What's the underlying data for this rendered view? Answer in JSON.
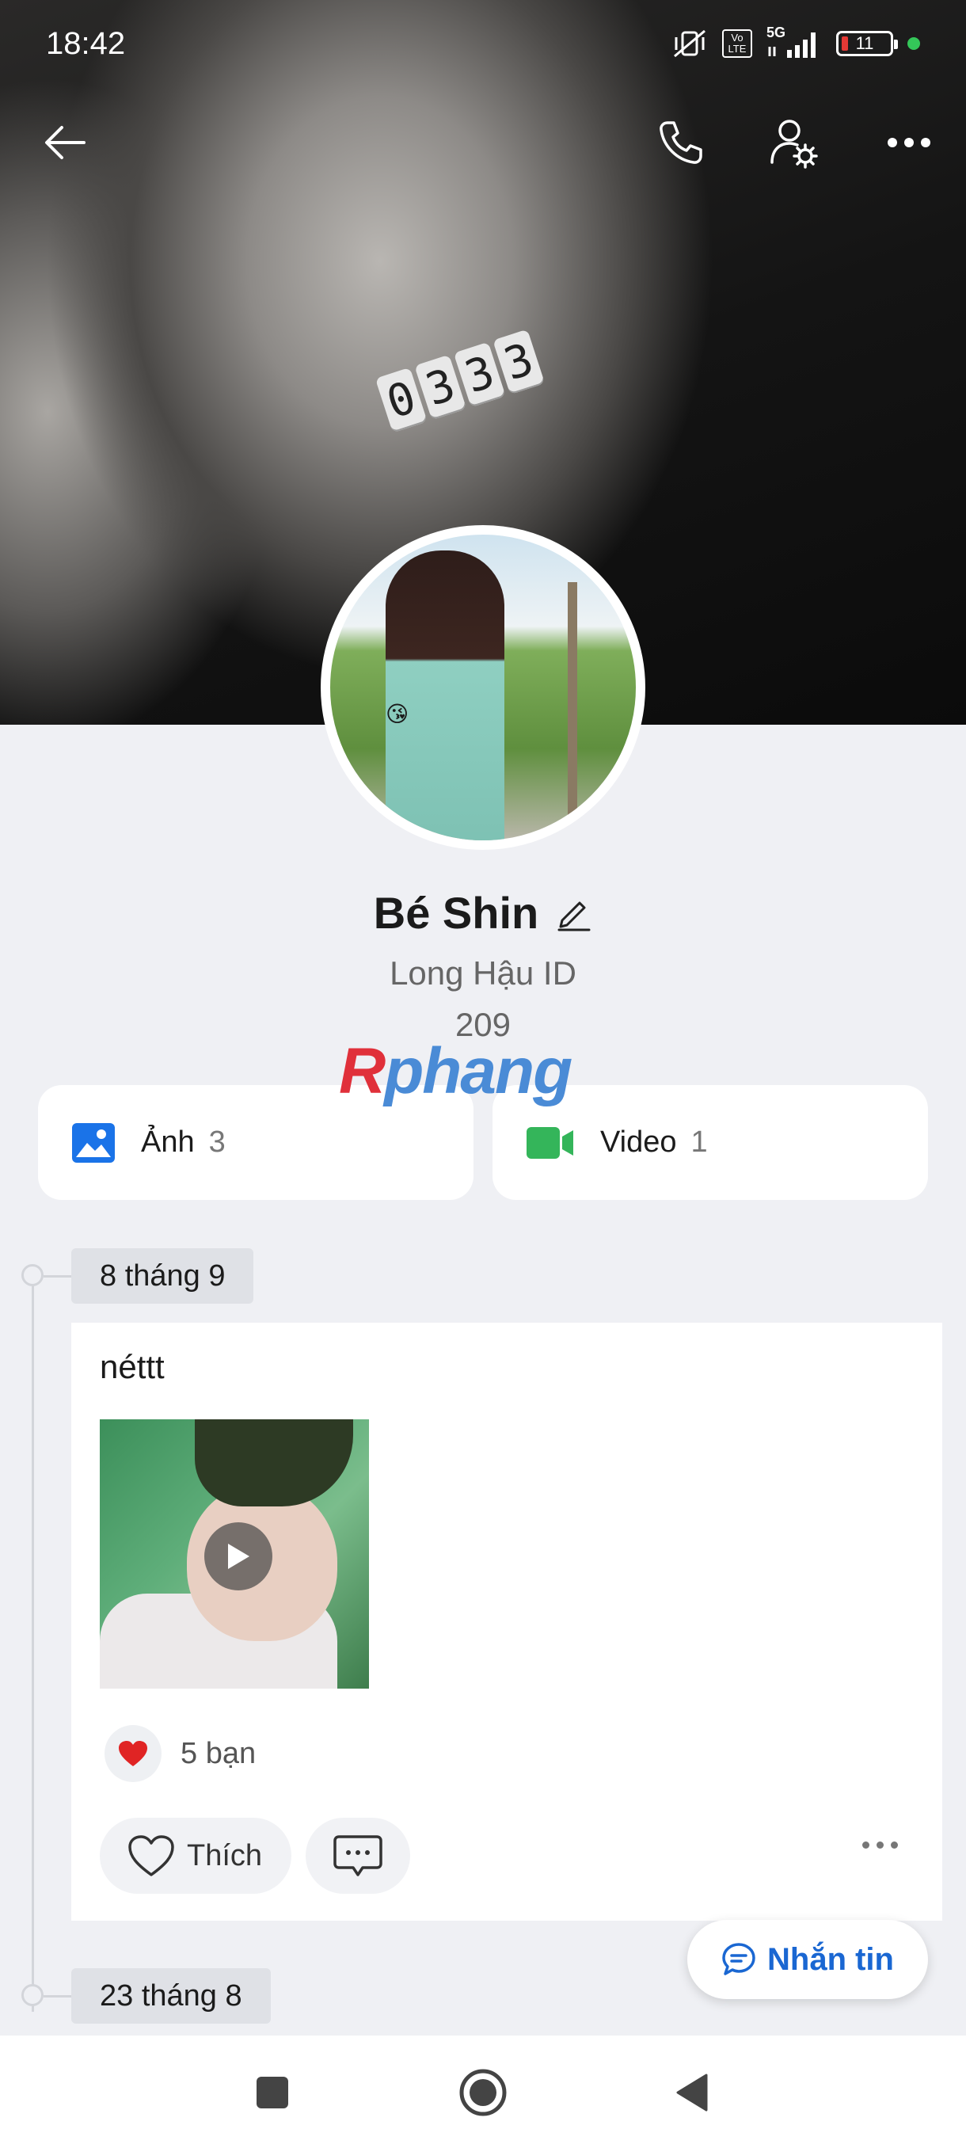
{
  "status_bar": {
    "time": "18:42",
    "network": "5G",
    "volte": "Vo LTE",
    "battery": "11"
  },
  "cover": {
    "clock_digits": [
      "0",
      "3",
      "3",
      "3"
    ]
  },
  "profile": {
    "name": "Bé Shin",
    "id_line": "Long Hậu ID",
    "number": "209"
  },
  "watermark": {
    "part1": "R",
    "part2": "phang"
  },
  "media": {
    "photos": {
      "label": "Ảnh",
      "count": "3"
    },
    "videos": {
      "label": "Video",
      "count": "1"
    }
  },
  "timeline": {
    "groups": [
      {
        "date": "8 tháng 9",
        "post": {
          "text": "néttt",
          "reaction_count": "5 bạn",
          "like_label": "Thích"
        }
      },
      {
        "date": "23 tháng 8"
      }
    ]
  },
  "message_button": {
    "label": "Nhắn tin"
  },
  "colors": {
    "accent": "#1a67d2",
    "photo_icon": "#1a73e8",
    "video_icon": "#34b55a",
    "heart": "#e02424"
  }
}
